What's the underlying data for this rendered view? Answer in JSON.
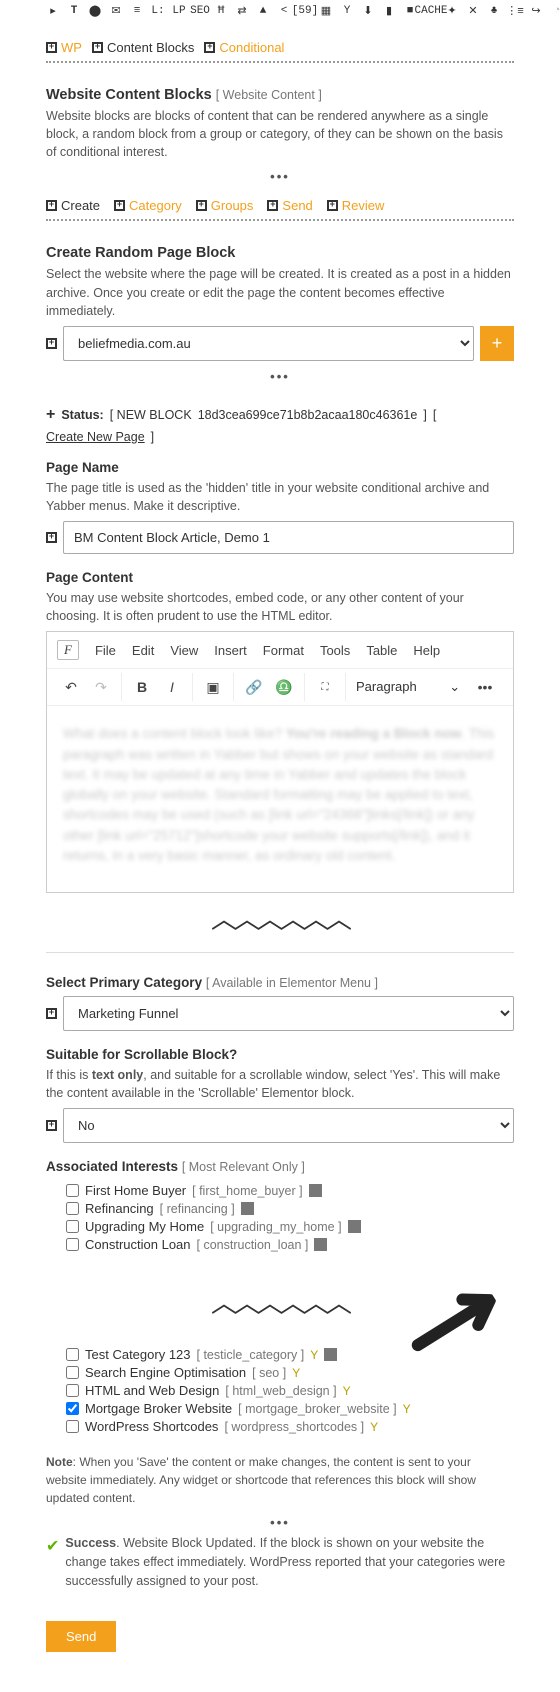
{
  "tabs": {
    "wp": "WP",
    "content_blocks": "Content Blocks",
    "conditional": "Conditional"
  },
  "section1": {
    "title": "Website Content Blocks",
    "sub": "[ Website Content ]",
    "para": "Website blocks are blocks of content that can be rendered anywhere as a single block, a random block from a group or category, of they can be shown on the basis of conditional interest."
  },
  "subtabs": {
    "create": "Create",
    "category": "Category",
    "groups": "Groups",
    "send": "Send",
    "review": "Review"
  },
  "create": {
    "title": "Create Random Page Block",
    "para": "Select the website where the page will be created. It is created as a post in a hidden archive. Once you create or edit the page the content becomes effective immediately.",
    "site_value": "beliefmedia.com.au"
  },
  "status": {
    "label": "Status:",
    "prefix": "[ NEW BLOCK",
    "id": "18d3cea699ce71b8b2acaa180c46361e",
    "suffix": "]",
    "link": "Create New Page"
  },
  "page_name": {
    "title": "Page Name",
    "para": "The page title is used as the 'hidden' title in your website conditional archive and Yabber menus. Make it descriptive.",
    "value": "BM Content Block Article, Demo 1"
  },
  "page_content": {
    "title": "Page Content",
    "para": "You may use website shortcodes, embed code, or any other content of your choosing. It is often prudent to use the HTML editor."
  },
  "editor_menu": {
    "file": "File",
    "edit": "Edit",
    "view": "View",
    "insert": "Insert",
    "format": "Format",
    "tools": "Tools",
    "table": "Table",
    "help": "Help"
  },
  "paragraph_label": "Paragraph",
  "category": {
    "title": "Select Primary Category",
    "sub": "[ Available in Elementor Menu ]",
    "value": "Marketing Funnel"
  },
  "scrollable": {
    "title": "Suitable for Scrollable Block?",
    "para_pre": "If this is ",
    "para_bold": "text only",
    "para_post": ", and suitable for a scrollable window, select 'Yes'. This will make the content available in the 'Scrollable' Elementor block.",
    "value": "No"
  },
  "interests": {
    "title": "Associated Interests",
    "sub": "[ Most Relevant Only ]",
    "items": [
      {
        "label": "First Home Buyer",
        "slug": "first_home_buyer",
        "calc": true,
        "checked": false
      },
      {
        "label": "Refinancing",
        "slug": "refinancing",
        "calc": true,
        "checked": false
      },
      {
        "label": "Upgrading My Home",
        "slug": "upgrading_my_home",
        "calc": true,
        "checked": false
      },
      {
        "label": "Construction Loan",
        "slug": "construction_loan",
        "calc": true,
        "checked": false
      }
    ],
    "items2": [
      {
        "label": "Test Category 123",
        "slug": "testicle_category",
        "y": true,
        "calc": true,
        "checked": false
      },
      {
        "label": "Search Engine Optimisation",
        "slug": "seo",
        "y": true,
        "checked": false
      },
      {
        "label": "HTML and Web Design",
        "slug": "html_web_design",
        "y": true,
        "checked": false
      },
      {
        "label": "Mortgage Broker Website",
        "slug": "mortgage_broker_website",
        "y": true,
        "checked": true
      },
      {
        "label": "WordPress Shortcodes",
        "slug": "wordpress_shortcodes",
        "y": true,
        "checked": false
      }
    ]
  },
  "note_pre": "Note",
  "note": ": When you 'Save' the content or make changes, the content is sent to your website immediately. Any widget or shortcode that references this block will show updated content.",
  "success_pre": "Success",
  "success": ". Website Block Updated. If the block is shown on your website the change takes effect immediately. WordPress reported that your categories were successfully assigned to your post.",
  "send_btn": "Send"
}
